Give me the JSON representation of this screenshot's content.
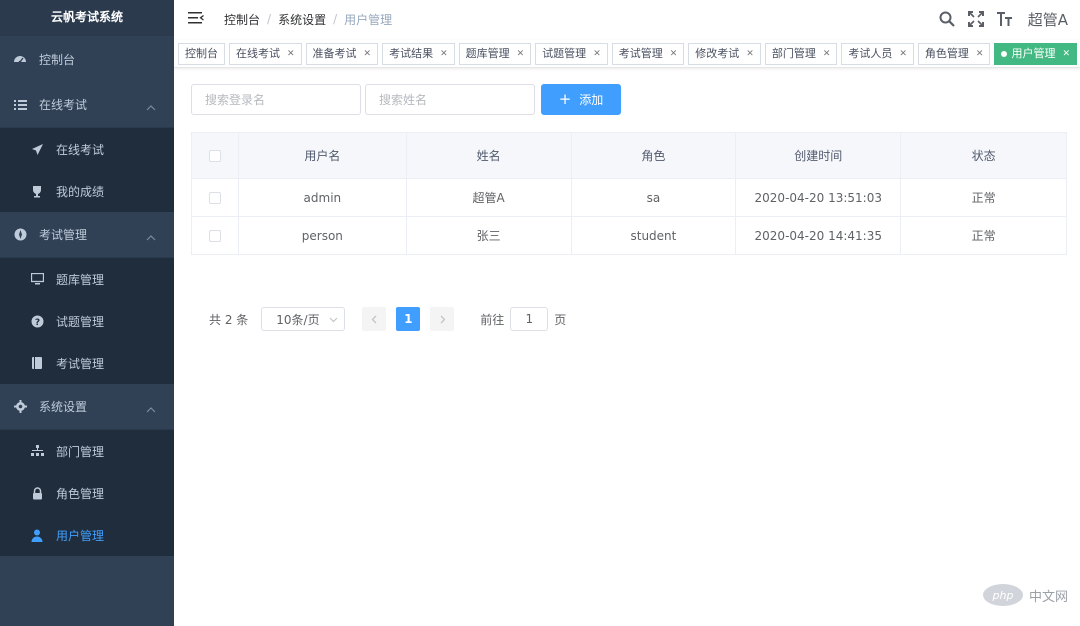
{
  "app": {
    "title": "云帆考试系统"
  },
  "sidebar": {
    "dashboard": "控制台",
    "groups": [
      {
        "label": "在线考试",
        "items": [
          "在线考试",
          "我的成绩"
        ]
      },
      {
        "label": "考试管理",
        "items": [
          "题库管理",
          "试题管理",
          "考试管理"
        ]
      },
      {
        "label": "系统设置",
        "items": [
          "部门管理",
          "角色管理",
          "用户管理"
        ]
      }
    ],
    "active_item": "用户管理",
    "active_color": "#409eff"
  },
  "header": {
    "breadcrumb": [
      "控制台",
      "系统设置",
      "用户管理"
    ],
    "user": "超管A"
  },
  "tags": {
    "items": [
      "控制台",
      "在线考试",
      "准备考试",
      "考试结果",
      "题库管理",
      "试题管理",
      "考试管理",
      "修改考试",
      "部门管理",
      "考试人员",
      "角色管理",
      "用户管理"
    ],
    "active": "用户管理",
    "active_color": "#42b983"
  },
  "filter": {
    "login_placeholder": "搜索登录名",
    "name_placeholder": "搜索姓名",
    "add_label": "添加"
  },
  "table": {
    "columns": [
      "用户名",
      "姓名",
      "角色",
      "创建时间",
      "状态"
    ],
    "rows": [
      {
        "username": "admin",
        "name": "超管A",
        "role": "sa",
        "created": "2020-04-20 13:51:03",
        "status": "正常"
      },
      {
        "username": "person",
        "name": "张三",
        "role": "student",
        "created": "2020-04-20 14:41:35",
        "status": "正常"
      }
    ]
  },
  "pagination": {
    "total": "共 2 条",
    "page_size": "10条/页",
    "current_page": "1",
    "goto_label": "前往",
    "goto_value": "1",
    "page_suffix": "页"
  },
  "watermark": {
    "logo": "php",
    "text": "中文网"
  }
}
